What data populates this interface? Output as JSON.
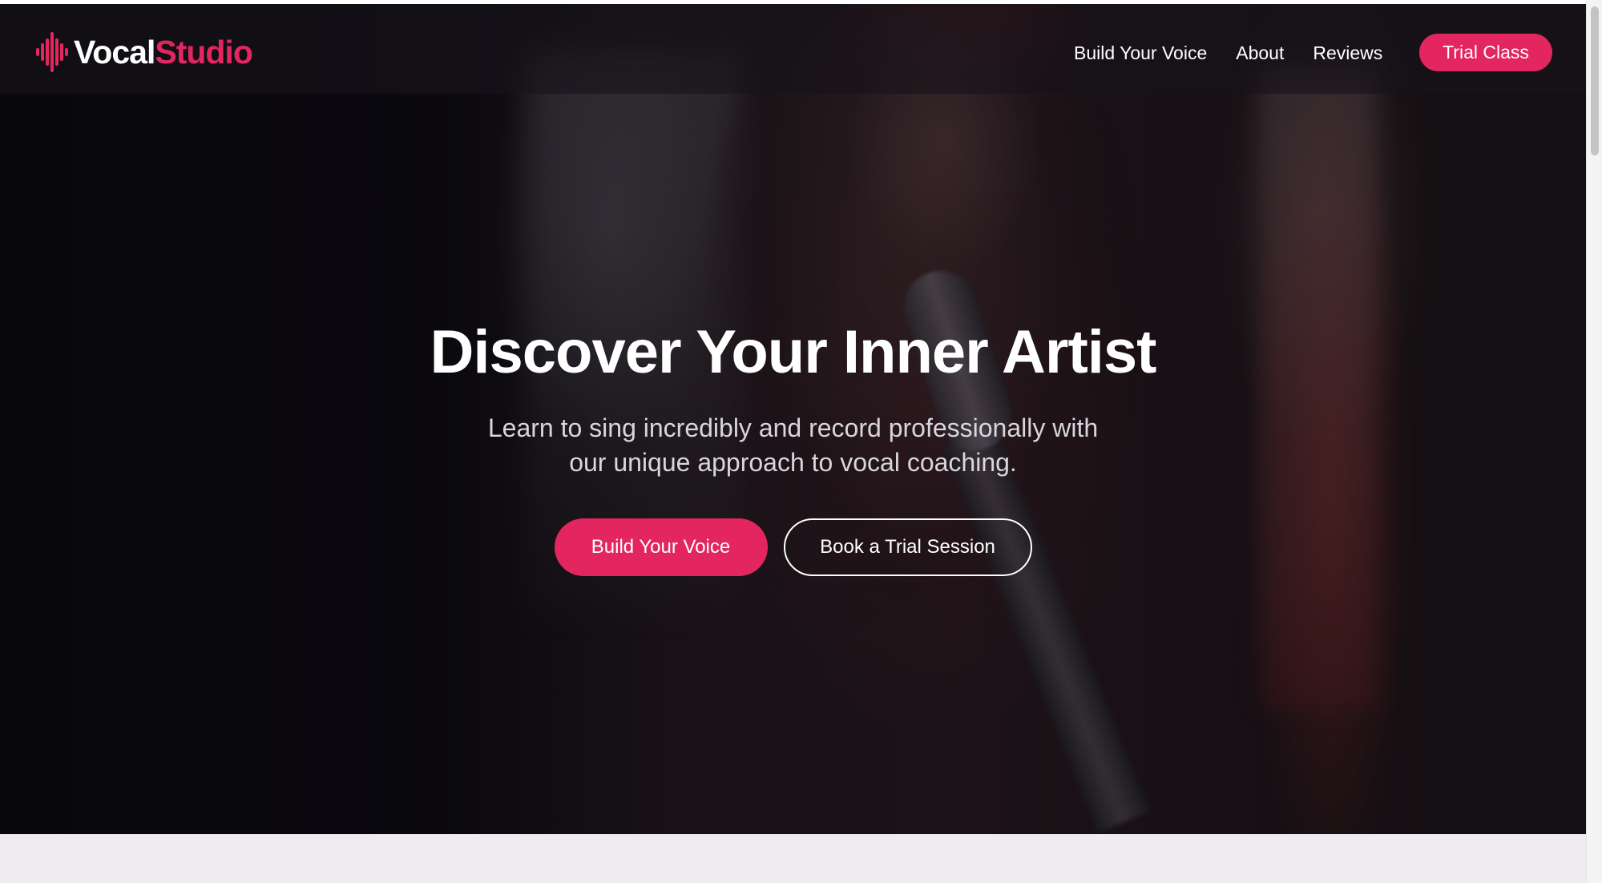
{
  "brand": {
    "name_part1": "Vocal",
    "name_part2": "Studio",
    "logo_icon": "soundwave-icon",
    "accent_color": "#e32660"
  },
  "nav": {
    "links": [
      {
        "label": "Build Your Voice"
      },
      {
        "label": "About"
      },
      {
        "label": "Reviews"
      }
    ],
    "cta_label": "Trial Class"
  },
  "hero": {
    "title": "Discover Your Inner Artist",
    "subtitle": "Learn to sing incredibly and record professionally with our unique approach to vocal coaching.",
    "primary_button": "Build Your Voice",
    "secondary_button": "Book a Trial Session"
  }
}
